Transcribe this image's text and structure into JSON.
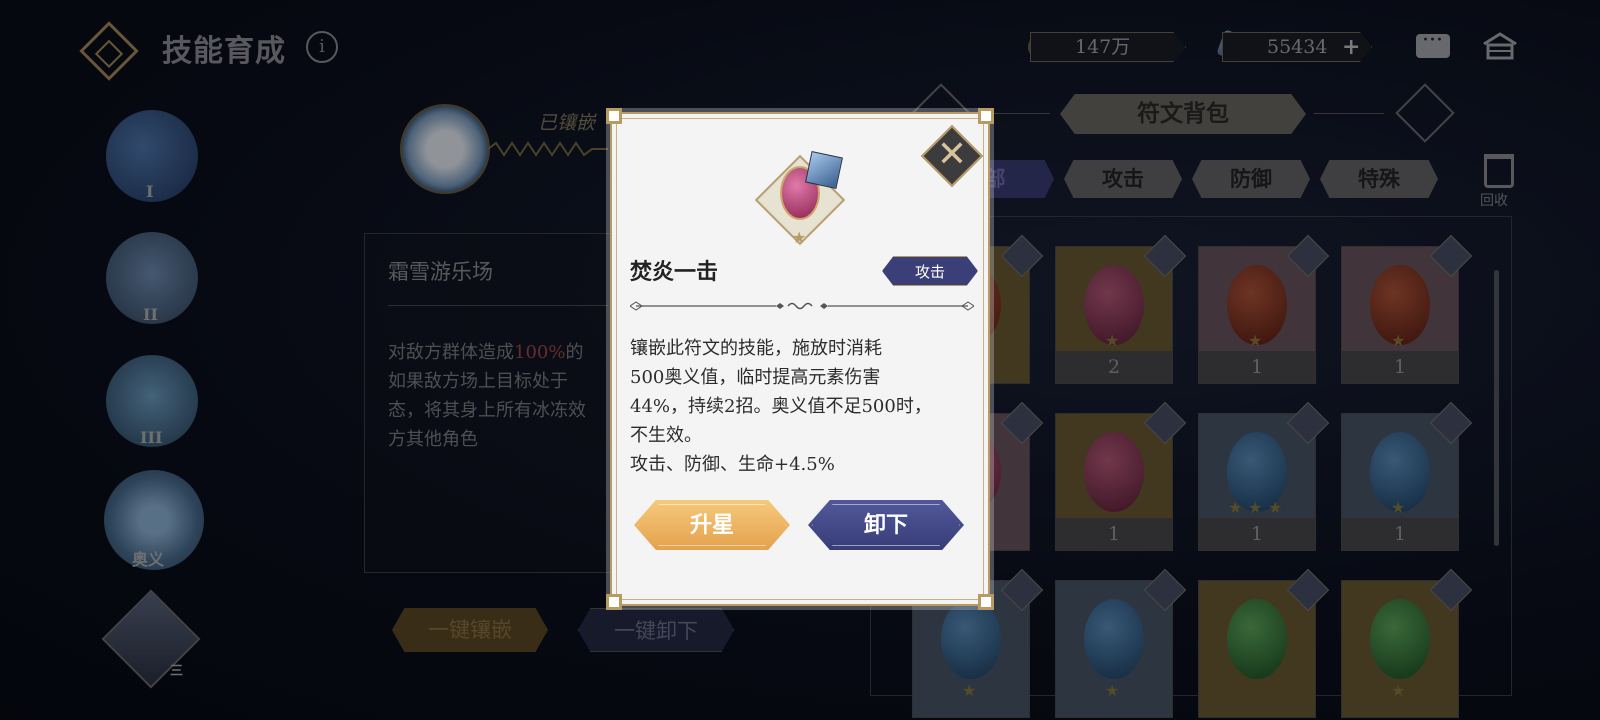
{
  "header": {
    "title": "技能育成",
    "info_icon": "i",
    "gold_amount": "147万",
    "gem_amount": "55434",
    "plus_symbol": "+"
  },
  "left_column": {
    "skills": [
      {
        "label": "I"
      },
      {
        "label": "II"
      },
      {
        "label": "III"
      },
      {
        "label": "奥义"
      }
    ],
    "character_badge": "三"
  },
  "center": {
    "equipped_label": "已镶嵌",
    "skill_name": "霜雪游乐场",
    "skill_desc_prefix": "对敌方群体造成",
    "skill_desc_highlight": "100%",
    "skill_desc_suffix": "的",
    "skill_desc_line2": "如果敌方场上目标处于",
    "skill_desc_line3": "态，将其身上所有冰冻效",
    "skill_desc_line4": "方其他角色",
    "embed_all_label": "一键镶嵌",
    "remove_all_label": "一键卸下"
  },
  "inventory": {
    "title": "符文背包",
    "filters": [
      "部",
      "攻击",
      "防御",
      "特殊"
    ],
    "recycle_label": "回收",
    "rows": [
      [
        {
          "bg": "gold",
          "gem": "fire",
          "count": "",
          "stars": 0
        },
        {
          "bg": "gold",
          "gem": "red",
          "count": "2",
          "stars": 1
        },
        {
          "bg": "pink",
          "gem": "fire",
          "count": "1",
          "stars": 1
        },
        {
          "bg": "pink",
          "gem": "fire",
          "count": "1",
          "stars": 1
        }
      ],
      [
        {
          "bg": "pink",
          "gem": "red",
          "count": "",
          "stars": 0
        },
        {
          "bg": "gold",
          "gem": "red",
          "count": "1",
          "stars": 0
        },
        {
          "bg": "blue",
          "gem": "blue",
          "count": "1",
          "stars": 3
        },
        {
          "bg": "blue",
          "gem": "blue",
          "count": "1",
          "stars": 1
        }
      ],
      [
        {
          "bg": "blue",
          "gem": "blue",
          "count": "",
          "stars": 1
        },
        {
          "bg": "blue",
          "gem": "blue",
          "count": "",
          "stars": 1
        },
        {
          "bg": "gold",
          "gem": "green",
          "count": "",
          "stars": 0
        },
        {
          "bg": "gold",
          "gem": "green",
          "count": "",
          "stars": 1
        }
      ]
    ]
  },
  "modal": {
    "rune_name": "焚炎一击",
    "rune_type": "攻击",
    "desc_line1": "镶嵌此符文的技能，施放时消耗",
    "desc_line2": "500奥义值，临时提高元素伤害",
    "desc_line3": "44%，持续2招。奥义值不足500时，",
    "desc_line4": "不生效。",
    "desc_line5": "攻击、防御、生命+4.5%",
    "upstar_label": "升星",
    "unequip_label": "卸下",
    "close_symbol": "✕",
    "star_symbol": "★"
  }
}
